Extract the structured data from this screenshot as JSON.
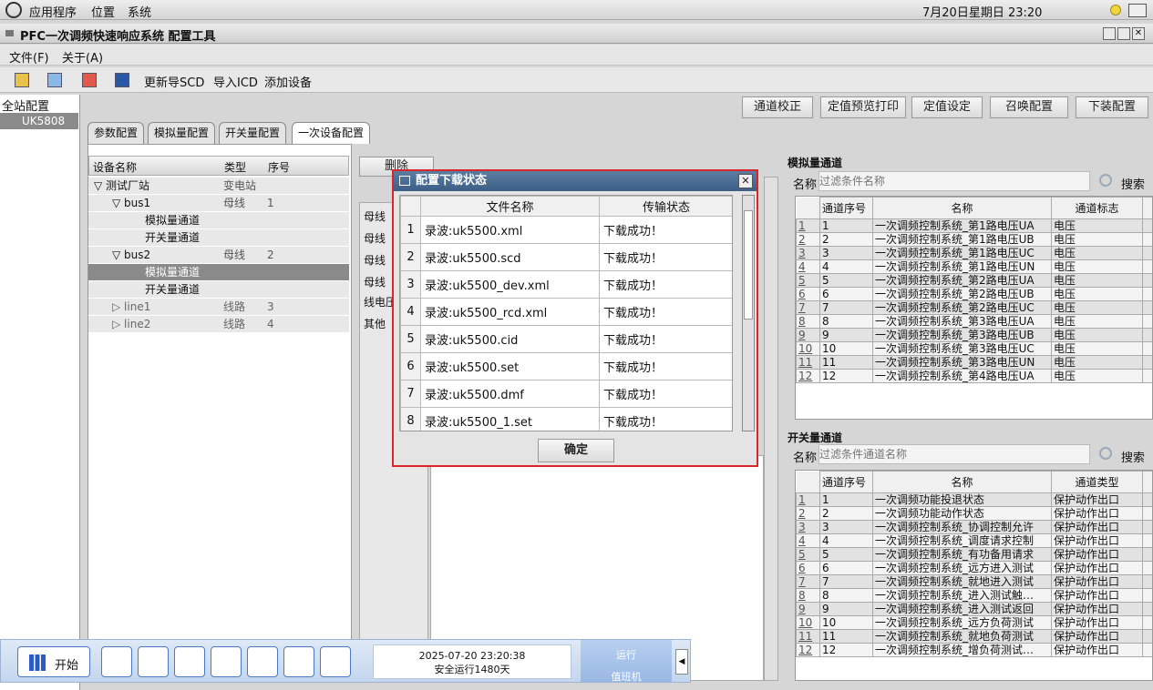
{
  "top": {
    "apps": "应用程序",
    "places": "位置",
    "system": "系统",
    "clock": "7月20日星期日 23:20"
  },
  "window": {
    "title": "PFC一次调频快速响应系统 配置工具"
  },
  "menu": {
    "file": "文件(F)",
    "about": "关于(A)"
  },
  "toolbar": {
    "export_scd": "更新导SCD",
    "import_icd": "导入ICD",
    "add_device": "添加设备"
  },
  "tree": {
    "root": "全站配置",
    "device": "UK5808"
  },
  "actions": {
    "calib": "通道校正",
    "preview": "定值预览打印",
    "set": "定值设定",
    "recall": "召唤配置",
    "download": "下装配置"
  },
  "tabs": [
    "参数配置",
    "模拟量配置",
    "开关量配置",
    "一次设备配置"
  ],
  "device_table": {
    "headers": [
      "设备名称",
      "类型",
      "序号"
    ],
    "rows": [
      {
        "name": "▽ 测试厂站",
        "type": "变电站",
        "no": ""
      },
      {
        "name": "▽ bus1",
        "type": "母线",
        "no": "1"
      },
      {
        "name": "模拟量通道",
        "type": "",
        "no": ""
      },
      {
        "name": "开关量通道",
        "type": "",
        "no": ""
      },
      {
        "name": "▽ bus2",
        "type": "母线",
        "no": "2"
      },
      {
        "name": "模拟量通道",
        "type": "",
        "no": ""
      },
      {
        "name": "开关量通道",
        "type": "",
        "no": ""
      },
      {
        "name": "▷ line1",
        "type": "线路",
        "no": "3"
      },
      {
        "name": "▷ line2",
        "type": "线路",
        "no": "4"
      }
    ]
  },
  "mid": {
    "delete": "删除",
    "items": [
      "母线",
      "母线",
      "母线",
      "母线",
      "线电压",
      "其他"
    ]
  },
  "analog": {
    "section": "模拟量通道",
    "name_label": "名称",
    "placeholder": "过滤条件名称",
    "search": "搜索",
    "headers": [
      "通道序号",
      "名称",
      "通道标志"
    ],
    "rows": [
      [
        "1",
        "1",
        "一次调频控制系统_第1路电压UA",
        "电压"
      ],
      [
        "2",
        "2",
        "一次调频控制系统_第1路电压UB",
        "电压"
      ],
      [
        "3",
        "3",
        "一次调频控制系统_第1路电压UC",
        "电压"
      ],
      [
        "4",
        "4",
        "一次调频控制系统_第1路电压UN",
        "电压"
      ],
      [
        "5",
        "5",
        "一次调频控制系统_第2路电压UA",
        "电压"
      ],
      [
        "6",
        "6",
        "一次调频控制系统_第2路电压UB",
        "电压"
      ],
      [
        "7",
        "7",
        "一次调频控制系统_第2路电压UC",
        "电压"
      ],
      [
        "8",
        "8",
        "一次调频控制系统_第3路电压UA",
        "电压"
      ],
      [
        "9",
        "9",
        "一次调频控制系统_第3路电压UB",
        "电压"
      ],
      [
        "10",
        "10",
        "一次调频控制系统_第3路电压UC",
        "电压"
      ],
      [
        "11",
        "11",
        "一次调频控制系统_第3路电压UN",
        "电压"
      ],
      [
        "12",
        "12",
        "一次调频控制系统_第4路电压UA",
        "电压"
      ]
    ]
  },
  "switch": {
    "section": "开关量通道",
    "name_label": "名称",
    "placeholder": "过滤条件通道名称",
    "search": "搜索",
    "headers": [
      "通道序号",
      "名称",
      "通道类型"
    ],
    "rows": [
      [
        "1",
        "1",
        "一次调频功能投退状态",
        "保护动作出口"
      ],
      [
        "2",
        "2",
        "一次调频功能动作状态",
        "保护动作出口"
      ],
      [
        "3",
        "3",
        "一次调频控制系统_协调控制允许",
        "保护动作出口"
      ],
      [
        "4",
        "4",
        "一次调频控制系统_调度请求控制",
        "保护动作出口"
      ],
      [
        "5",
        "5",
        "一次调频控制系统_有功备用请求",
        "保护动作出口"
      ],
      [
        "6",
        "6",
        "一次调频控制系统_远方进入测试",
        "保护动作出口"
      ],
      [
        "7",
        "7",
        "一次调频控制系统_就地进入测试",
        "保护动作出口"
      ],
      [
        "8",
        "8",
        "一次调频控制系统_进入测试触…",
        "保护动作出口"
      ],
      [
        "9",
        "9",
        "一次调频控制系统_进入测试返回",
        "保护动作出口"
      ],
      [
        "10",
        "10",
        "一次调频控制系统_远方负荷测试",
        "保护动作出口"
      ],
      [
        "11",
        "11",
        "一次调频控制系统_就地负荷测试",
        "保护动作出口"
      ],
      [
        "12",
        "12",
        "一次调频控制系统_增负荷测试…",
        "保护动作出口"
      ]
    ]
  },
  "dialog": {
    "title": "配置下载状态",
    "headers": [
      "文件名称",
      "传输状态"
    ],
    "rows": [
      [
        "1",
        "录波:uk5500.xml",
        "下载成功！"
      ],
      [
        "2",
        "录波:uk5500.scd",
        "下载成功！"
      ],
      [
        "3",
        "录波:uk5500_dev.xml",
        "下载成功！"
      ],
      [
        "4",
        "录波:uk5500_rcd.xml",
        "下载成功！"
      ],
      [
        "5",
        "录波:uk5500.cid",
        "下载成功！"
      ],
      [
        "6",
        "录波:uk5500.set",
        "下载成功！"
      ],
      [
        "7",
        "录波:uk5500.dmf",
        "下载成功！"
      ],
      [
        "8",
        "录波:uk5500_1.set",
        "下载成功！"
      ]
    ],
    "ok": "确定"
  },
  "taskbar": {
    "start": "开始",
    "datetime": "2025-07-20 23:20:38",
    "uptime": "安全运行1480天",
    "status": "运行",
    "role": "值班机"
  }
}
